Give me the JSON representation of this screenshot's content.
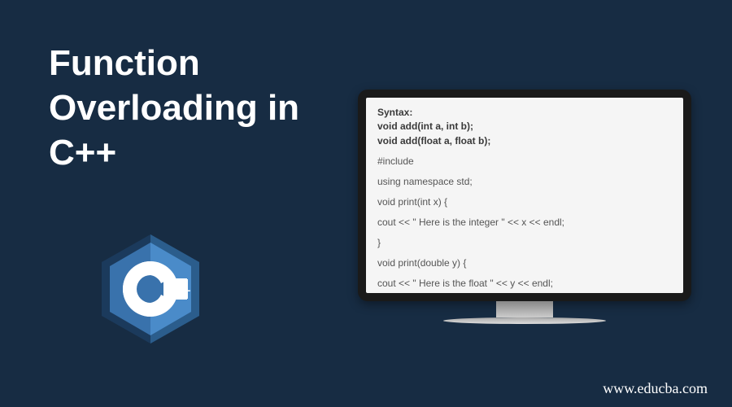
{
  "title_line1": "Function",
  "title_line2": "Overloading in",
  "title_line3": "C++",
  "logo": {
    "letter": "C",
    "suffix": "++"
  },
  "code": {
    "syntax_label": "Syntax:",
    "syntax_line1": "void add(int a, int b);",
    "syntax_line2": "void add(float a, float b);",
    "line1": "#include",
    "line2": "using namespace std;",
    "line3": "void print(int x) {",
    "line4": "cout << \" Here is the integer \" << x << endl;",
    "line5": "}",
    "line6": "void print(double  y) {",
    "line7": "cout << \" Here is the float \" << y << endl;",
    "line8": "}"
  },
  "url": "www.educba.com"
}
